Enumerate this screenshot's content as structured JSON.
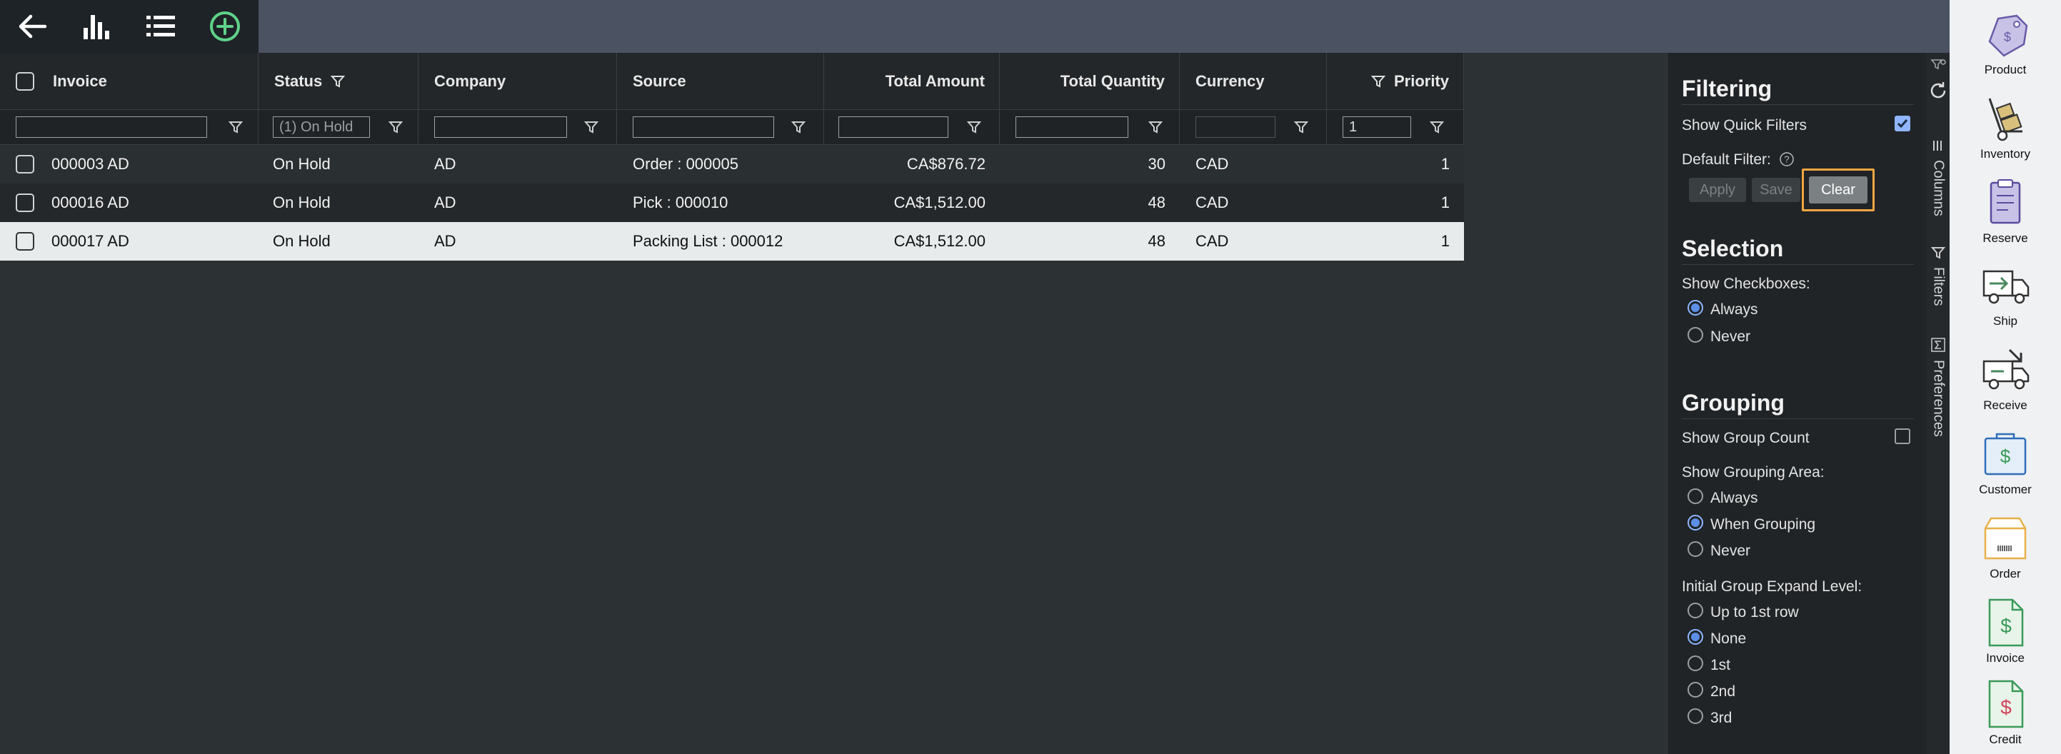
{
  "toolbar": {
    "icons": [
      "back-arrow-icon",
      "bar-chart-icon",
      "list-icon",
      "add-circle-icon"
    ]
  },
  "grid": {
    "columns": [
      "Invoice",
      "Status",
      "Company",
      "Source",
      "Total Amount",
      "Total Quantity",
      "Currency",
      "Priority"
    ],
    "filters": {
      "invoice": "",
      "status": "(1) On Hold",
      "company": "",
      "source": "",
      "total_amount": "",
      "total_quantity": "",
      "currency": "",
      "priority": "1"
    },
    "rows": [
      {
        "invoice": "000003 AD",
        "status": "On Hold",
        "company": "AD",
        "source": "Order : 000005",
        "total_amount": "CA$876.72",
        "total_quantity": "30",
        "currency": "CAD",
        "priority": "1"
      },
      {
        "invoice": "000016 AD",
        "status": "On Hold",
        "company": "AD",
        "source": "Pick : 000010",
        "total_amount": "CA$1,512.00",
        "total_quantity": "48",
        "currency": "CAD",
        "priority": "1"
      },
      {
        "invoice": "000017 AD",
        "status": "On Hold",
        "company": "AD",
        "source": "Packing List : 000012",
        "total_amount": "CA$1,512.00",
        "total_quantity": "48",
        "currency": "CAD",
        "priority": "1"
      }
    ]
  },
  "prefs": {
    "filtering": {
      "title": "Filtering",
      "show_quick_filters": "Show Quick Filters",
      "default_filter": "Default Filter:",
      "apply": "Apply",
      "save": "Save",
      "clear": "Clear"
    },
    "selection": {
      "title": "Selection",
      "show_checkboxes": "Show Checkboxes:",
      "always": "Always",
      "never": "Never"
    },
    "grouping": {
      "title": "Grouping",
      "show_group_count": "Show Group Count",
      "show_grouping_area": "Show Grouping Area:",
      "always": "Always",
      "when_grouping": "When Grouping",
      "never": "Never",
      "initial_expand": "Initial Group Expand Level:",
      "up_to_first": "Up to 1st row",
      "none": "None",
      "first": "1st",
      "second": "2nd",
      "third": "3rd"
    }
  },
  "vtabs": {
    "columns": "Columns",
    "filters": "Filters",
    "preferences": "Preferences"
  },
  "sidebar": {
    "items": [
      "Product",
      "Inventory",
      "Reserve",
      "Ship",
      "Receive",
      "Customer",
      "Order",
      "Invoice",
      "Credit"
    ]
  },
  "colors": {
    "accent": "#f0a640",
    "add_green": "#5fd38a",
    "top_bar": "#4b5262"
  }
}
